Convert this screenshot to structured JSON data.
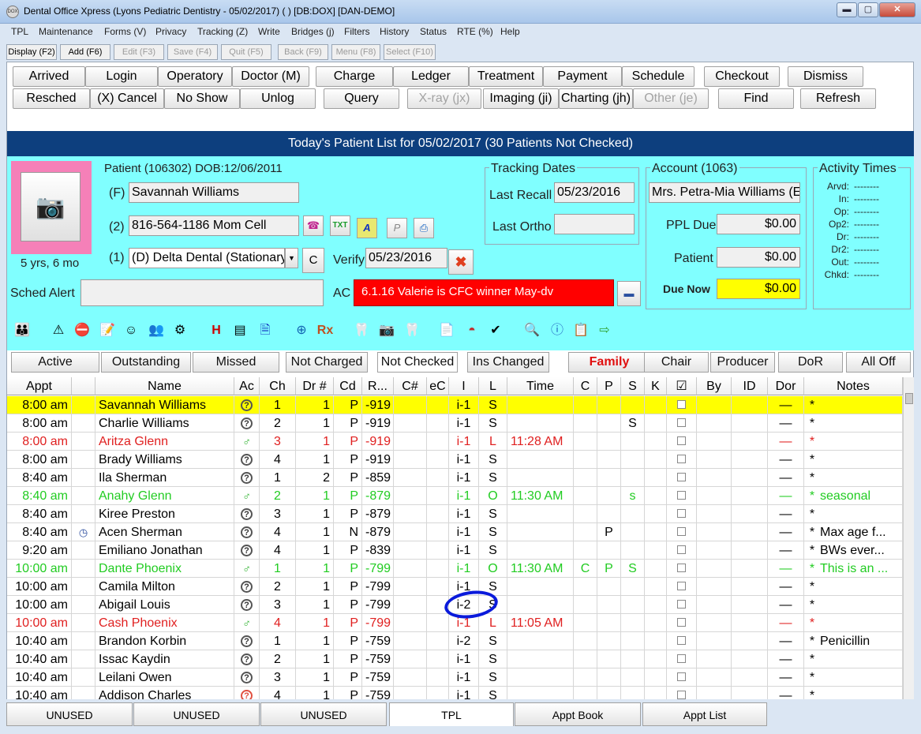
{
  "window": {
    "title": "Dental Office Xpress (Lyons Pediatric Dentistry - 05/02/2017) ( ) [DB:DOX] [DAN-DEMO]",
    "app_icon": "DOX"
  },
  "menu": [
    "TPL",
    "Maintenance",
    "Forms (V)",
    "Privacy",
    "Tracking (Z)",
    "Write",
    "Bridges (j)",
    "Filters",
    "History",
    "Status",
    "RTE (%)",
    "Help"
  ],
  "fkeys": [
    "Display (F2)",
    "Add (F6)",
    "Edit (F3)",
    "Save (F4)",
    "Quit (F5)",
    "Back (F9)",
    "Menu (F8)",
    "Select (F10)"
  ],
  "buttons_row1": [
    "Arrived",
    "Login",
    "Operatory",
    "Doctor (M)",
    "Charge",
    "Ledger",
    "Treatment",
    "Payment",
    "Schedule",
    "Checkout",
    "Dismiss"
  ],
  "buttons_row2": [
    "Resched",
    "(X) Cancel",
    "No Show",
    "Unlog",
    "Query",
    "X-ray (jx)",
    "Imaging (ji)",
    "Charting (jh)",
    "Other (je)",
    "Find",
    "Refresh"
  ],
  "banner": "Today's Patient List for 05/02/2017 (30 Patients Not Checked)",
  "patient": {
    "header": "Patient (106302)  DOB:12/06/2011",
    "age": "5 yrs, 6 mo",
    "name_label": "(F)",
    "name": "Savannah Williams",
    "phone_label": "(2)",
    "phone": "816-564-1186  Mom Cell",
    "ins_label": "(1)",
    "insurance": "(D) Delta Dental (Stationary",
    "c_button": "C",
    "verify_label": "Verify",
    "verify_date": "05/23/2016",
    "sched_alert_label": "Sched Alert",
    "sched_alert": "",
    "ac_label": "AC",
    "ac_text": "6.1.16 Valerie is CFC winner May-dv"
  },
  "tracking": {
    "title": "Tracking Dates",
    "last_recall_label": "Last Recall",
    "last_recall": "05/23/2016",
    "last_ortho_label": "Last Ortho",
    "last_ortho": ""
  },
  "account": {
    "title": "Account (1063)",
    "name": "Mrs. Petra-Mia Williams (Er",
    "ppl_due_label": "PPL Due",
    "ppl_due": "$0.00",
    "patient_label": "Patient",
    "patient_amt": "$0.00",
    "due_now_label": "Due Now",
    "due_now": "$0.00"
  },
  "activity": {
    "title": "Activity Times",
    "items": [
      {
        "label": "Arvd:",
        "value": "--------"
      },
      {
        "label": "In:",
        "value": "--------"
      },
      {
        "label": "Op:",
        "value": "--------"
      },
      {
        "label": "Op2:",
        "value": "--------"
      },
      {
        "label": "Dr:",
        "value": "--------"
      },
      {
        "label": "Dr2:",
        "value": "--------"
      },
      {
        "label": "Out:",
        "value": "--------"
      },
      {
        "label": "Chkd:",
        "value": "--------"
      }
    ]
  },
  "filters": [
    "Active",
    "Outstanding",
    "Missed",
    "Not Charged",
    "Not Checked",
    "Ins Changed",
    "Family",
    "Chair",
    "Producer",
    "DoR",
    "All Off"
  ],
  "columns": [
    "Appt",
    "",
    "Name",
    "Ac",
    "Ch",
    "Dr #",
    "Cd",
    "R...",
    "C#",
    "eC",
    "I",
    "L",
    "Time",
    "C",
    "P",
    "S",
    "K",
    "☑",
    "By",
    "ID",
    "Dor",
    "Notes"
  ],
  "rows": [
    {
      "appt": "8:00 am",
      "flag": "",
      "name": "Savannah Williams",
      "ac": "?",
      "ch": "1",
      "dr": "1",
      "cd": "P",
      "r": "-919",
      "i": "i-1",
      "l": "S",
      "time": "",
      "c": "",
      "p": "",
      "s": "",
      "dor": "—",
      "star": "*",
      "notes": "",
      "style": "selected"
    },
    {
      "appt": "8:00 am",
      "flag": "",
      "name": "Charlie Williams",
      "ac": "?",
      "ch": "2",
      "dr": "1",
      "cd": "P",
      "r": "-919",
      "i": "i-1",
      "l": "S",
      "time": "",
      "c": "",
      "p": "",
      "s": "S",
      "dor": "—",
      "star": "*",
      "notes": "",
      "style": "normal"
    },
    {
      "appt": "8:00 am",
      "flag": "",
      "name": "Aritza Glenn",
      "ac": "person",
      "ch": "3",
      "dr": "1",
      "cd": "P",
      "r": "-919",
      "i": "i-1",
      "l": "L",
      "time": "11:28 AM",
      "c": "",
      "p": "",
      "s": "",
      "dor": "—",
      "star": "*",
      "notes": "",
      "style": "red"
    },
    {
      "appt": "8:00 am",
      "flag": "",
      "name": "Brady Williams",
      "ac": "?",
      "ch": "4",
      "dr": "1",
      "cd": "P",
      "r": "-919",
      "i": "i-1",
      "l": "S",
      "time": "",
      "c": "",
      "p": "",
      "s": "",
      "dor": "—",
      "star": "*",
      "notes": "",
      "style": "normal"
    },
    {
      "appt": "8:40 am",
      "flag": "",
      "name": "Ila Sherman",
      "ac": "?",
      "ch": "1",
      "dr": "2",
      "cd": "P",
      "r": "-859",
      "i": "i-1",
      "l": "S",
      "time": "",
      "c": "",
      "p": "",
      "s": "",
      "dor": "—",
      "star": "*",
      "notes": "",
      "style": "normal"
    },
    {
      "appt": "8:40 am",
      "flag": "",
      "name": "Anahy Glenn",
      "ac": "person",
      "ch": "2",
      "dr": "1",
      "cd": "P",
      "r": "-879",
      "i": "i-1",
      "l": "O",
      "time": "11:30 AM",
      "c": "",
      "p": "",
      "s": "s",
      "dor": "—",
      "star": "*",
      "notes": "seasonal",
      "style": "green"
    },
    {
      "appt": "8:40 am",
      "flag": "",
      "name": "Kiree Preston",
      "ac": "?",
      "ch": "3",
      "dr": "1",
      "cd": "P",
      "r": "-879",
      "i": "i-1",
      "l": "S",
      "time": "",
      "c": "",
      "p": "",
      "s": "",
      "dor": "—",
      "star": "*",
      "notes": "",
      "style": "normal"
    },
    {
      "appt": "8:40 am",
      "flag": "clock",
      "name": "Acen Sherman",
      "ac": "?",
      "ch": "4",
      "dr": "1",
      "cd": "N",
      "r": "-879",
      "i": "i-1",
      "l": "S",
      "time": "",
      "c": "",
      "p": "P",
      "s": "",
      "dor": "—",
      "star": "*",
      "notes": "Max age f...",
      "style": "normal"
    },
    {
      "appt": "9:20 am",
      "flag": "",
      "name": "Emiliano Jonathan",
      "ac": "?",
      "ch": "4",
      "dr": "1",
      "cd": "P",
      "r": "-839",
      "i": "i-1",
      "l": "S",
      "time": "",
      "c": "",
      "p": "",
      "s": "",
      "dor": "—",
      "star": "*",
      "notes": "BWs ever...",
      "style": "normal"
    },
    {
      "appt": "10:00 am",
      "flag": "",
      "name": "Dante Phoenix",
      "ac": "person",
      "ch": "1",
      "dr": "1",
      "cd": "P",
      "r": "-799",
      "i": "i-1",
      "l": "O",
      "time": "11:30 AM",
      "c": "C",
      "p": "P",
      "s": "S",
      "dor": "—",
      "star": "*",
      "notes": "This is an ...",
      "style": "green"
    },
    {
      "appt": "10:00 am",
      "flag": "",
      "name": "Camila Milton",
      "ac": "?",
      "ch": "2",
      "dr": "1",
      "cd": "P",
      "r": "-799",
      "i": "i-1",
      "l": "S",
      "time": "",
      "c": "",
      "p": "",
      "s": "",
      "dor": "—",
      "star": "*",
      "notes": "",
      "style": "normal"
    },
    {
      "appt": "10:00 am",
      "flag": "",
      "name": "Abigail Louis",
      "ac": "?",
      "ch": "3",
      "dr": "1",
      "cd": "P",
      "r": "-799",
      "i": "i-2",
      "l": "S",
      "time": "",
      "c": "",
      "p": "",
      "s": "",
      "dor": "—",
      "star": "*",
      "notes": "",
      "style": "normal"
    },
    {
      "appt": "10:00 am",
      "flag": "",
      "name": "Cash Phoenix",
      "ac": "person",
      "ch": "4",
      "dr": "1",
      "cd": "P",
      "r": "-799",
      "i": "i-1",
      "l": "L",
      "time": "11:05 AM",
      "c": "",
      "p": "",
      "s": "",
      "dor": "—",
      "star": "*",
      "notes": "",
      "style": "red"
    },
    {
      "appt": "10:40 am",
      "flag": "",
      "name": "Brandon Korbin",
      "ac": "?",
      "ch": "1",
      "dr": "1",
      "cd": "P",
      "r": "-759",
      "i": "i-2",
      "l": "S",
      "time": "",
      "c": "",
      "p": "",
      "s": "",
      "dor": "—",
      "star": "*",
      "notes": "Penicillin",
      "style": "normal"
    },
    {
      "appt": "10:40 am",
      "flag": "",
      "name": "Issac Kaydin",
      "ac": "?",
      "ch": "2",
      "dr": "1",
      "cd": "P",
      "r": "-759",
      "i": "i-1",
      "l": "S",
      "time": "",
      "c": "",
      "p": "",
      "s": "",
      "dor": "—",
      "star": "*",
      "notes": "",
      "style": "normal"
    },
    {
      "appt": "10:40 am",
      "flag": "",
      "name": "Leilani Owen",
      "ac": "?",
      "ch": "3",
      "dr": "1",
      "cd": "P",
      "r": "-759",
      "i": "i-1",
      "l": "S",
      "time": "",
      "c": "",
      "p": "",
      "s": "",
      "dor": "—",
      "star": "*",
      "notes": "",
      "style": "normal"
    },
    {
      "appt": "10:40 am",
      "flag": "",
      "name": "Addison Charles",
      "ac": "?red",
      "ch": "4",
      "dr": "1",
      "cd": "P",
      "r": "-759",
      "i": "i-1",
      "l": "S",
      "time": "",
      "c": "",
      "p": "",
      "s": "",
      "dor": "—",
      "star": "*",
      "notes": "",
      "style": "normal"
    }
  ],
  "bottom_tabs": [
    "UNUSED",
    "UNUSED",
    "UNUSED",
    "TPL",
    "Appt Book",
    "Appt List"
  ],
  "colors": {
    "selected": "#ffff00",
    "red": "#e02020",
    "green": "#22cc22",
    "panel": "#80ffff",
    "banner": "#0d3f7e"
  },
  "icons": [
    "webcam-icon",
    "phone-icon",
    "add-phone-icon",
    "letter-a-icon",
    "letter-p-icon",
    "printer-icon",
    "close-x-icon",
    "card-icon"
  ]
}
